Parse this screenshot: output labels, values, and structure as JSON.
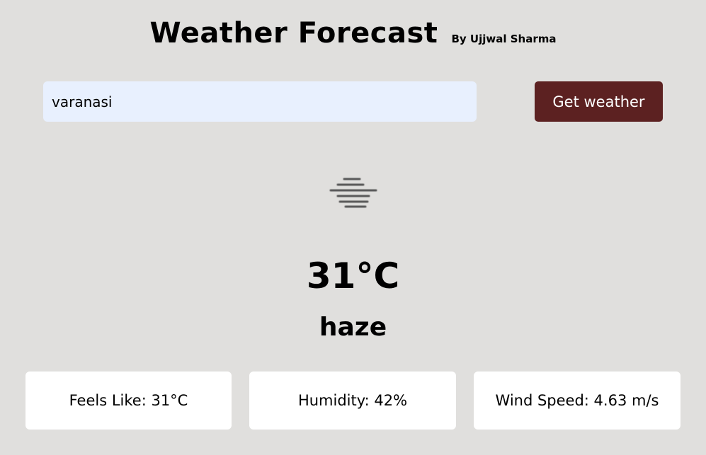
{
  "header": {
    "title": "Weather Forecast",
    "author": "By Ujjwal Sharma"
  },
  "search": {
    "value": "varanasi",
    "button_label": "Get weather"
  },
  "weather": {
    "icon": "haze-icon",
    "temperature": "31°C",
    "condition": "haze"
  },
  "details": [
    {
      "label": "Feels Like: 31°C"
    },
    {
      "label": "Humidity: 42%"
    },
    {
      "label": "Wind Speed: 4.63 m/s"
    }
  ],
  "colors": {
    "background": "#e0dfdd",
    "input_background": "#e8f0fe",
    "button_background": "#5c2121",
    "button_text": "#ffffff",
    "card_background": "#ffffff",
    "icon_color": "#555555"
  }
}
